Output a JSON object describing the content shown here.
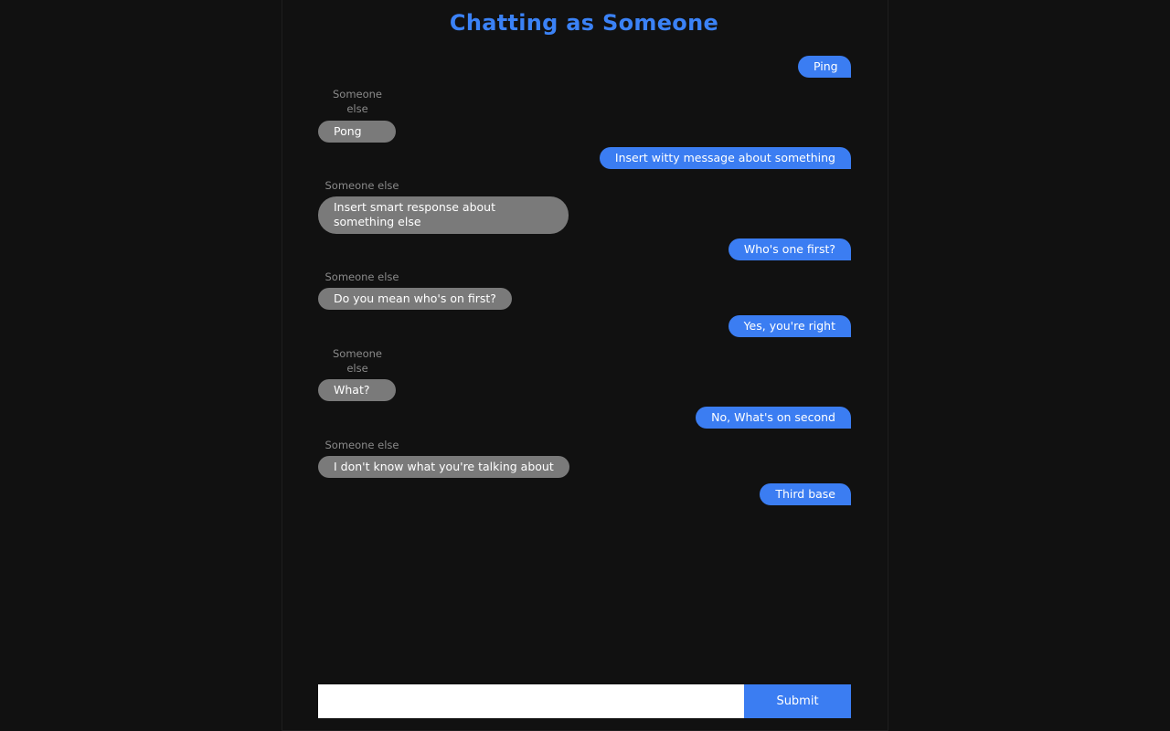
{
  "header": {
    "title": "Chatting as Someone"
  },
  "messages": [
    {
      "from": "me",
      "text": "Ping"
    },
    {
      "from": "other",
      "sender": "Someone else",
      "text": "Pong"
    },
    {
      "from": "me",
      "text": "Insert witty message about something"
    },
    {
      "from": "other",
      "sender": "Someone else",
      "text": "Insert smart response about something else"
    },
    {
      "from": "me",
      "text": "Who's one first?"
    },
    {
      "from": "other",
      "sender": "Someone else",
      "text": "Do you mean who's on first?"
    },
    {
      "from": "me",
      "text": "Yes, you're right"
    },
    {
      "from": "other",
      "sender": "Someone else",
      "text": "What?"
    },
    {
      "from": "me",
      "text": "No, What's on second"
    },
    {
      "from": "other",
      "sender": "Someone else",
      "text": "I don't know what you're talking about"
    },
    {
      "from": "me",
      "text": "Third base"
    }
  ],
  "composer": {
    "input_value": "",
    "placeholder": "",
    "submit_label": "Submit"
  },
  "colors": {
    "accent": "#3b7df2",
    "other_bubble": "#7a7a7a",
    "background": "#111111"
  }
}
